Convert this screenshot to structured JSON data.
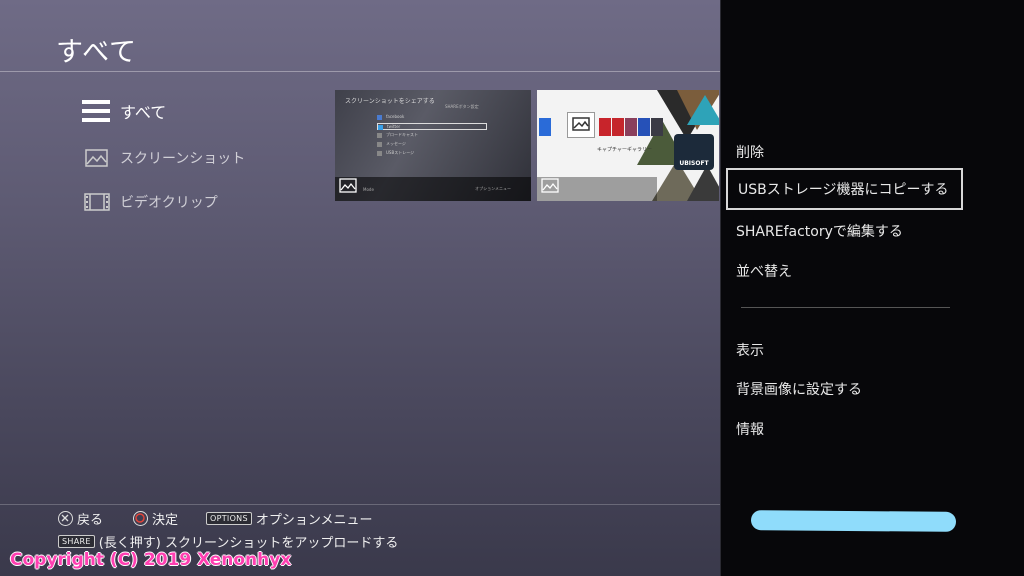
{
  "header": {
    "title": "すべて"
  },
  "categories": [
    {
      "label": "すべて",
      "icon": "list-icon"
    },
    {
      "label": "スクリーンショット",
      "icon": "image-icon"
    },
    {
      "label": "ビデオクリップ",
      "icon": "film-icon"
    }
  ],
  "thumbnails": {
    "first": {
      "title": "スクリーンショットをシェアする",
      "subtitle": "SHAREボタン設定",
      "rows": [
        "facebook",
        "twitter",
        "ブロードキャスト",
        "メッセージ",
        "USBストレージ"
      ],
      "bar_left": "Mode",
      "bar_right": "オプションメニュー"
    },
    "second": {
      "capture_label": "キャプチャーギャラリー",
      "brand": "UBISOFT"
    }
  },
  "options_menu": {
    "items": [
      "削除",
      "USBストレージ機器にコピーする",
      "SHAREfactoryで編集する",
      "並べ替え",
      "表示",
      "背景画像に設定する",
      "情報"
    ]
  },
  "footer": {
    "back_label": "戻る",
    "confirm_label": "決定",
    "options_button": "OPTIONS",
    "options_label": "オプションメニュー",
    "share_button": "SHARE",
    "share_label": "(長く押す) スクリーンショットをアップロードする"
  },
  "watermark": "Copyright (C) 2019 Xenonhyx",
  "colors": {
    "panel_bg": "#07070a",
    "watermark": "#ff3fb1",
    "redaction": "#8fdcfb"
  }
}
